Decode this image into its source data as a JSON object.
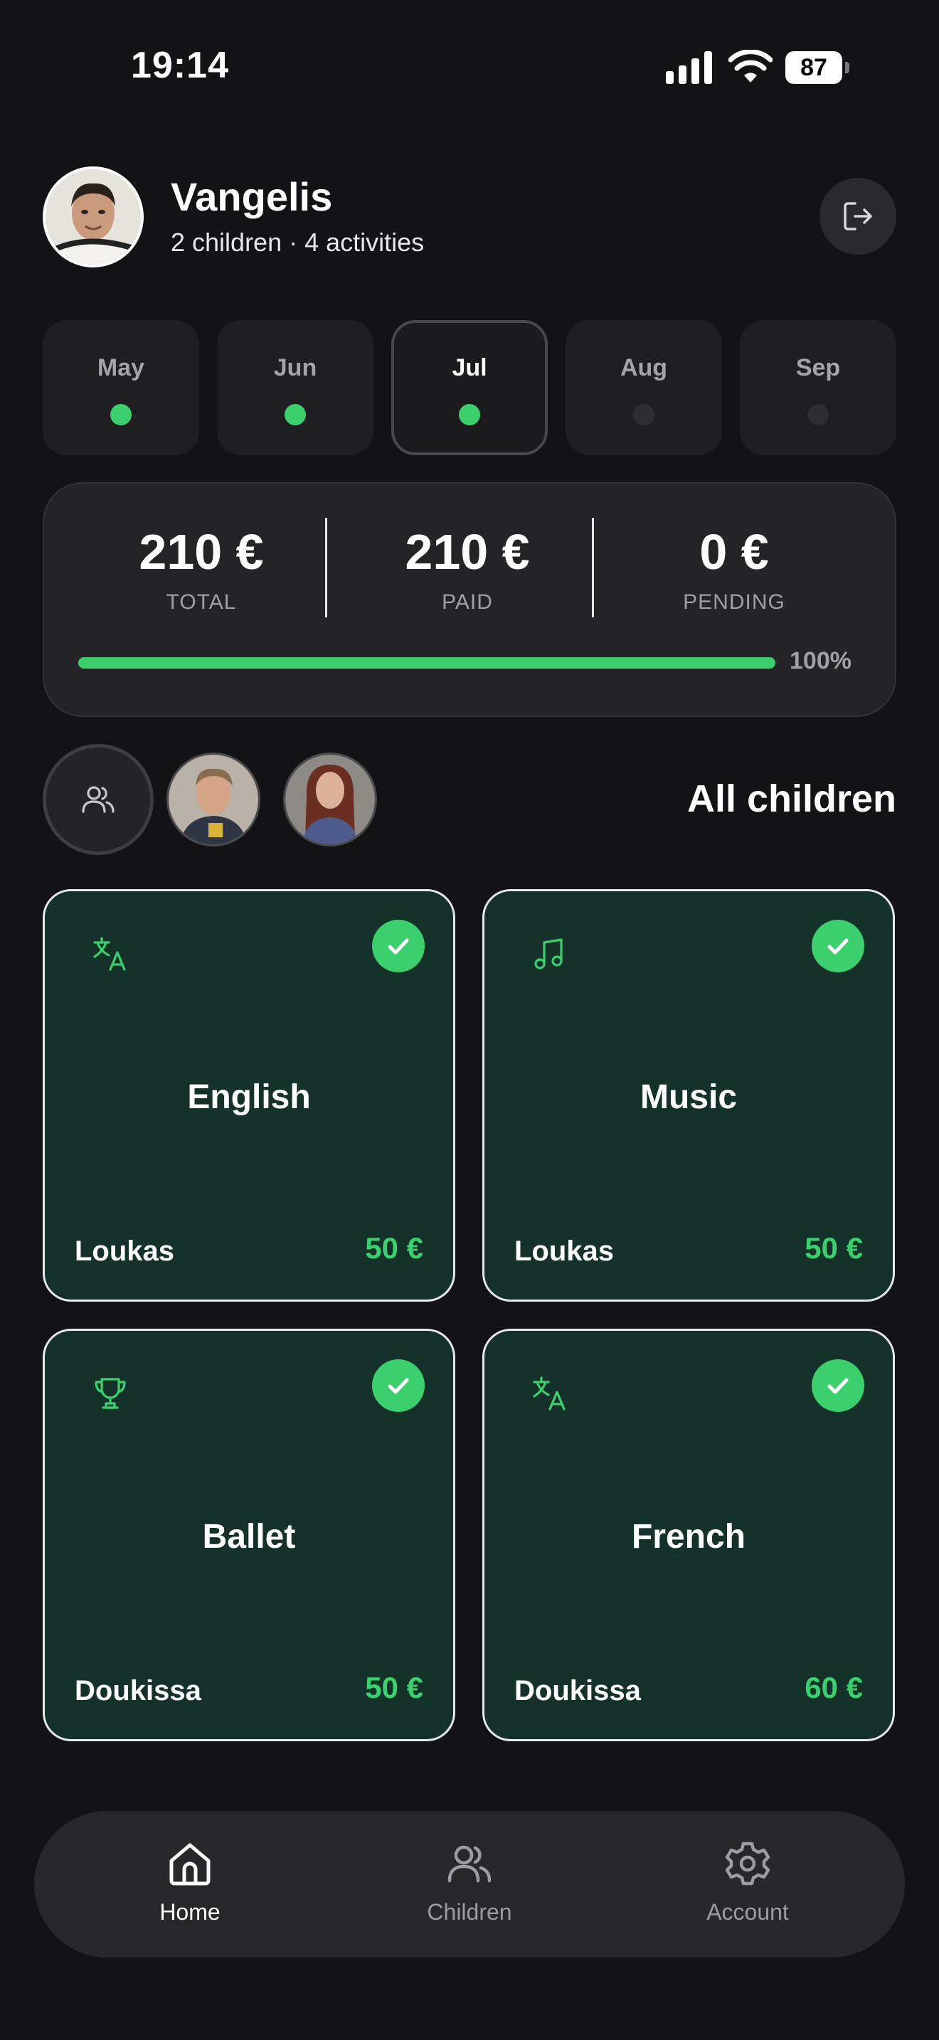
{
  "status_bar": {
    "time": "19:14",
    "battery": "87"
  },
  "header": {
    "name": "Vangelis",
    "subtitle": "2 children · 4 activities"
  },
  "months": [
    {
      "label": "May",
      "status": "paid"
    },
    {
      "label": "Jun",
      "status": "paid"
    },
    {
      "label": "Jul",
      "status": "paid",
      "selected": true
    },
    {
      "label": "Aug",
      "status": "none"
    },
    {
      "label": "Sep",
      "status": "none"
    }
  ],
  "summary": {
    "total_value": "210 €",
    "total_label": "TOTAL",
    "paid_value": "210 €",
    "paid_label": "PAID",
    "pending_value": "0 €",
    "pending_label": "PENDING",
    "progress_text": "100%",
    "progress_fraction": 1.0
  },
  "children_filter": {
    "title": "All children"
  },
  "activities": [
    {
      "title": "English",
      "child": "Loukas",
      "price": "50 €",
      "icon": "translate-icon",
      "paid": true
    },
    {
      "title": "Music",
      "child": "Loukas",
      "price": "50 €",
      "icon": "music-note-icon",
      "paid": true
    },
    {
      "title": "Ballet",
      "child": "Doukissa",
      "price": "50 €",
      "icon": "trophy-icon",
      "paid": true
    },
    {
      "title": "French",
      "child": "Doukissa",
      "price": "60 €",
      "icon": "translate-icon",
      "paid": true
    }
  ],
  "nav": {
    "home": "Home",
    "children": "Children",
    "account": "Account"
  },
  "colors": {
    "accent": "#3ccf6e",
    "background": "#131315",
    "card": "#15322a",
    "surface": "#242427"
  }
}
